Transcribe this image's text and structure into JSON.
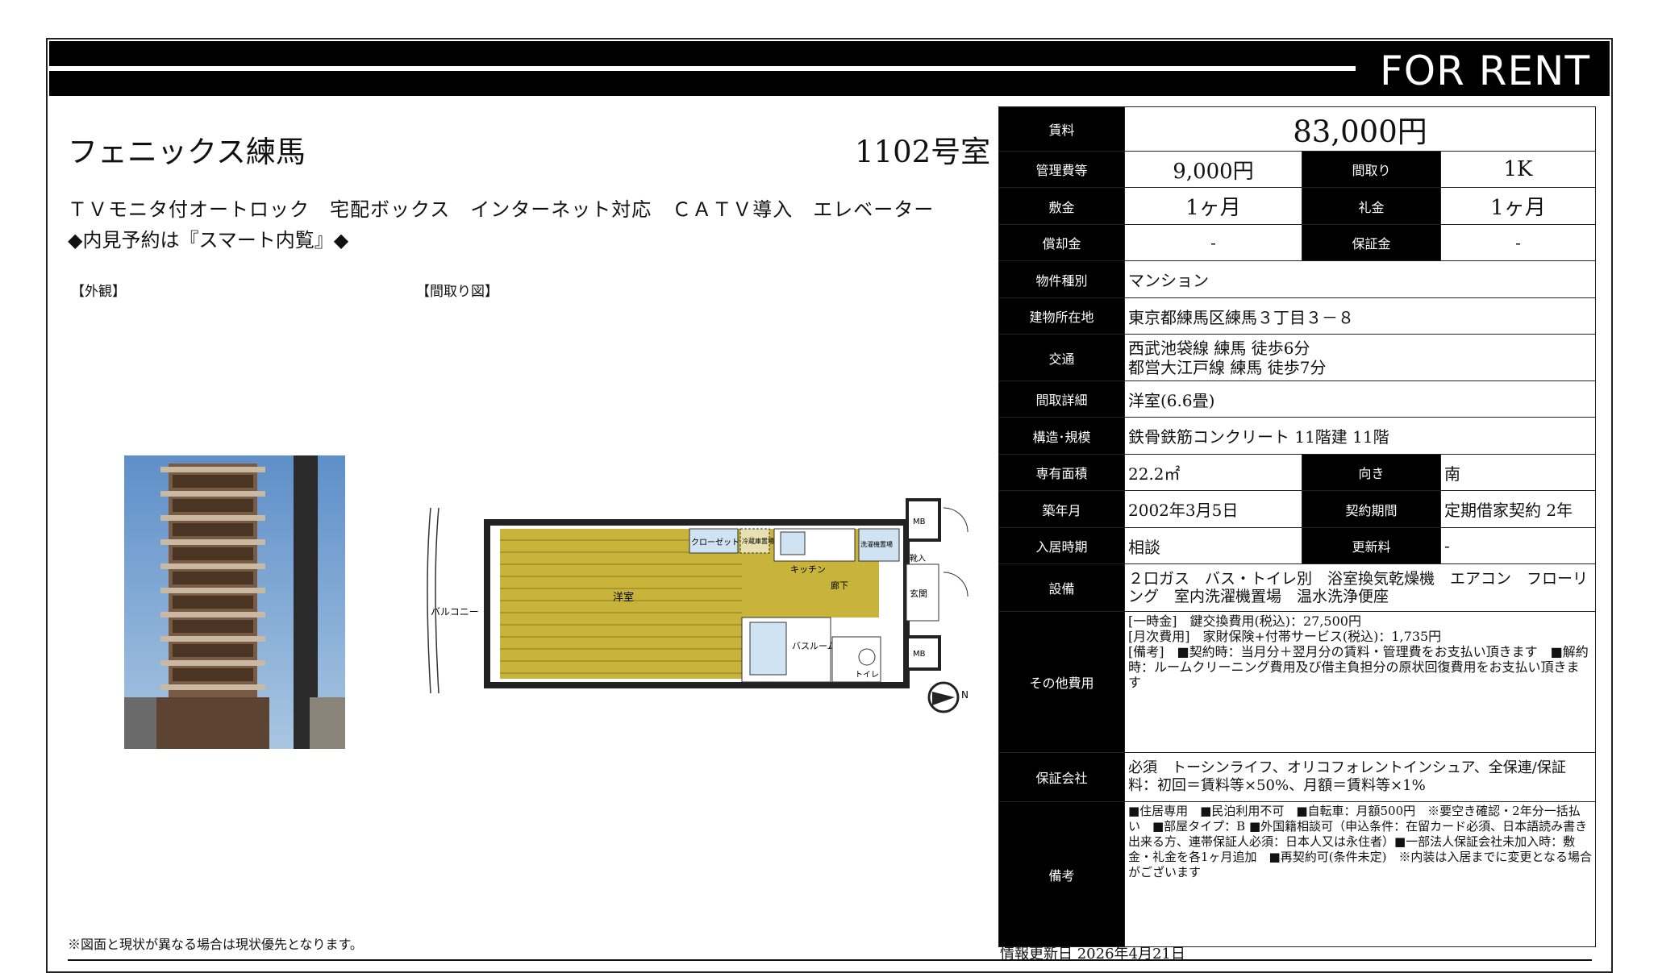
{
  "header": {
    "label": "FOR RENT"
  },
  "property": {
    "name": "フェニックス練馬",
    "room": "1102号室",
    "features": "ＴＶモニタ付オートロック　宅配ボックス　インターネット対応　ＣＡＴＶ導入　エレベーター",
    "booking_note": "◆内見予約は『スマート内覧』◆"
  },
  "captions": {
    "exterior": "【外観】",
    "floorplan": "【間取り図】"
  },
  "floorplan_labels": {
    "western_room": "洋室",
    "balcony": "バルコニー",
    "closet": "クローゼット",
    "fridge": "冷蔵庫置場",
    "kitchen": "キッチン",
    "hallway": "廊下",
    "bathroom": "バスルーム",
    "toilet": "トイレ",
    "entrance": "玄関",
    "shoe_box": "靴入",
    "washer": "洗濯機置場",
    "storage_1": "MB",
    "storage_2": "MB",
    "compass": "N"
  },
  "spec": {
    "rent": {
      "label": "賃料",
      "value": "83,000円"
    },
    "management_fee": {
      "label": "管理費等",
      "value": "9,000円"
    },
    "layout": {
      "label": "間取り",
      "value": "1K"
    },
    "deposit": {
      "label": "敷金",
      "value": "1ヶ月"
    },
    "key_money": {
      "label": "礼金",
      "value": "1ヶ月"
    },
    "amortization": {
      "label": "償却金",
      "value": "-"
    },
    "guarantee_money": {
      "label": "保証金",
      "value": "-"
    },
    "property_type": {
      "label": "物件種別",
      "value": "マンション"
    },
    "address": {
      "label": "建物所在地",
      "value": "東京都練馬区練馬３丁目３－８"
    },
    "transport": {
      "label": "交通",
      "line1": "西武池袋線 練馬 徒歩6分",
      "line2": "都営大江戸線 練馬 徒歩7分"
    },
    "layout_detail": {
      "label": "間取詳細",
      "value": "洋室(6.6畳)"
    },
    "structure": {
      "label": "構造･規模",
      "value": "鉄骨鉄筋コンクリート 11階建 11階"
    },
    "area": {
      "label": "専有面積",
      "value": "22.2㎡"
    },
    "direction": {
      "label": "向き",
      "value": "南"
    },
    "built": {
      "label": "築年月",
      "value": "2002年3月5日"
    },
    "contract_period": {
      "label": "契約期間",
      "value": "定期借家契約 2年"
    },
    "move_in": {
      "label": "入居時期",
      "value": "相談"
    },
    "renewal_fee": {
      "label": "更新料",
      "value": "-"
    },
    "facilities": {
      "label": "設備",
      "value": "２口ガス　バス・トイレ別　浴室換気乾燥機　エアコン　フローリング　室内洗濯機置場　温水洗浄便座"
    },
    "other_costs": {
      "label": "その他費用",
      "line1": "[一時金]　鍵交換費用(税込)：27,500円",
      "line2": "[月次費用]　家財保険+付帯サービス(税込)：1,735円",
      "line3": "[備考]　■契約時：当月分＋翌月分の賃料・管理費をお支払い頂きます　■解約時：ルームクリーニング費用及び借主負担分の原状回復費用をお支払い頂きます"
    },
    "guarantor": {
      "label": "保証会社",
      "value": "必須　トーシンライフ、オリコフォレントインシュア、全保連/保証料：初回＝賃料等×50%、月額＝賃料等×1%"
    },
    "remarks": {
      "label": "備考",
      "value": "■住居専用　■民泊利用不可　■自転車：月額500円　※要空き確認・2年分一括払い　■部屋タイプ：B ■外国籍相談可（申込条件：在留カード必須、日本語読み書き出来る方、連帯保証人必須：日本人又は永住者）■一部法人保証会社未加入時：敷金・礼金を各1ヶ月追加　■再契約可(条件未定)　※内装は入居までに変更となる場合がございます"
    }
  },
  "footer": {
    "note": "※図面と現状が異なる場合は現状優先となります。",
    "updated": "情報更新日 2026年4月21日"
  },
  "colors": {
    "tatami": "#c8b43a",
    "sky": "#7aa6d4",
    "building": "#7a5a42",
    "header": "#000000"
  }
}
